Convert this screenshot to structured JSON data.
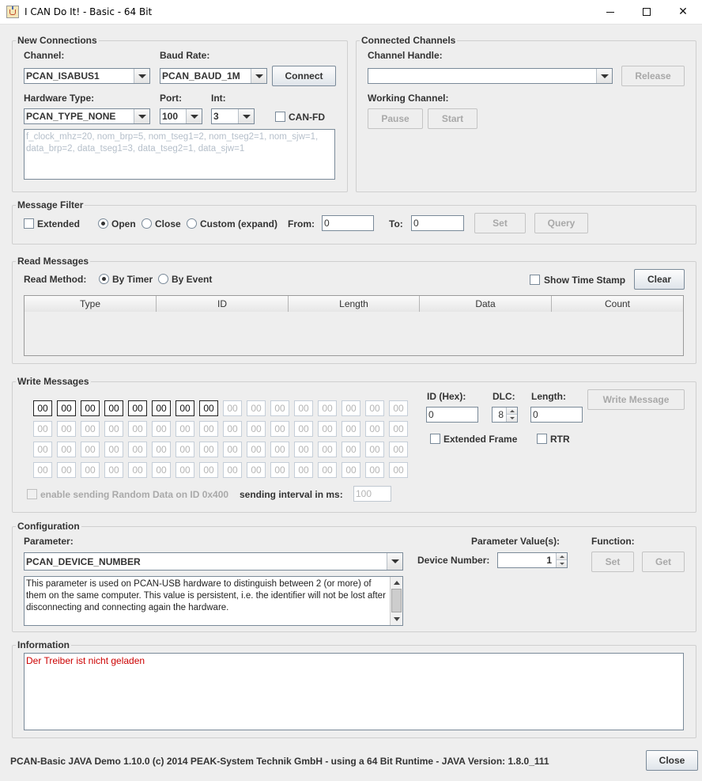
{
  "window": {
    "title": "I CAN Do It! - Basic - 64 Bit",
    "minimize_glyph": "—",
    "close_glyph": "✕"
  },
  "new_connections": {
    "legend": "New Connections",
    "channel_label": "Channel:",
    "channel_value": "PCAN_ISABUS1",
    "baud_label": "Baud Rate:",
    "baud_value": "PCAN_BAUD_1M",
    "connect_label": "Connect",
    "hwtype_label": "Hardware Type:",
    "hwtype_value": "PCAN_TYPE_NONE",
    "port_label": "Port:",
    "port_value": "100",
    "int_label": "Int:",
    "int_value": "3",
    "canfd_label": "CAN-FD",
    "bitrate_text": "f_clock_mhz=20, nom_brp=5, nom_tseg1=2, nom_tseg2=1, nom_sjw=1, data_brp=2, data_tseg1=3, data_tseg2=1, data_sjw=1"
  },
  "connected_channels": {
    "legend": "Connected Channels",
    "handle_label": "Channel Handle:",
    "handle_value": "",
    "release_label": "Release",
    "working_label": "Working Channel:",
    "pause_label": "Pause",
    "start_label": "Start"
  },
  "message_filter": {
    "legend": "Message Filter",
    "extended_label": "Extended",
    "open_label": "Open",
    "close_label": "Close",
    "custom_label": "Custom (expand)",
    "from_label": "From:",
    "from_value": "0",
    "to_label": "To:",
    "to_value": "0",
    "set_label": "Set",
    "query_label": "Query"
  },
  "read_messages": {
    "legend": "Read Messages",
    "method_label": "Read Method:",
    "by_timer_label": "By Timer",
    "by_event_label": "By Event",
    "timestamp_label": "Show Time Stamp",
    "clear_label": "Clear",
    "columns": [
      "Type",
      "ID",
      "Length",
      "Data",
      "Count"
    ]
  },
  "write_messages": {
    "legend": "Write Messages",
    "bytes": [
      "00",
      "00",
      "00",
      "00",
      "00",
      "00",
      "00",
      "00",
      "00",
      "00",
      "00",
      "00",
      "00",
      "00",
      "00",
      "00",
      "00",
      "00",
      "00",
      "00",
      "00",
      "00",
      "00",
      "00",
      "00",
      "00",
      "00",
      "00",
      "00",
      "00",
      "00",
      "00",
      "00",
      "00",
      "00",
      "00",
      "00",
      "00",
      "00",
      "00",
      "00",
      "00",
      "00",
      "00",
      "00",
      "00",
      "00",
      "00",
      "00",
      "00",
      "00",
      "00",
      "00",
      "00",
      "00",
      "00",
      "00",
      "00",
      "00",
      "00",
      "00",
      "00",
      "00",
      "00"
    ],
    "enabled_bytes": 8,
    "id_label": "ID (Hex):",
    "id_value": "0",
    "dlc_label": "DLC:",
    "dlc_value": "8",
    "length_label": "Length:",
    "length_value": "0",
    "write_label": "Write Message",
    "extended_frame_label": "Extended Frame",
    "rtr_label": "RTR",
    "random_label": "enable sending Random Data on ID 0x400",
    "interval_label": "sending interval in ms:",
    "interval_value": "100"
  },
  "configuration": {
    "legend": "Configuration",
    "parameter_label": "Parameter:",
    "parameter_value": "PCAN_DEVICE_NUMBER",
    "values_label": "Parameter Value(s):",
    "function_label": "Function:",
    "device_number_label": "Device Number:",
    "device_number_value": "1",
    "set_label": "Set",
    "get_label": "Get",
    "description": "This parameter is used on PCAN-USB hardware to distinguish between 2 (or more) of them on the same computer. This value is persistent, i.e. the identifier will not be lost after disconnecting and connecting again the hardware."
  },
  "information": {
    "legend": "Information",
    "message": "Der Treiber ist nicht geladen",
    "message_color": "#cc0000"
  },
  "footer": {
    "status": "PCAN-Basic JAVA Demo 1.10.0  (c) 2014 PEAK-System Technik GmbH - using a 64 Bit Runtime - JAVA Version: 1.8.0_111",
    "close_label": "Close"
  }
}
